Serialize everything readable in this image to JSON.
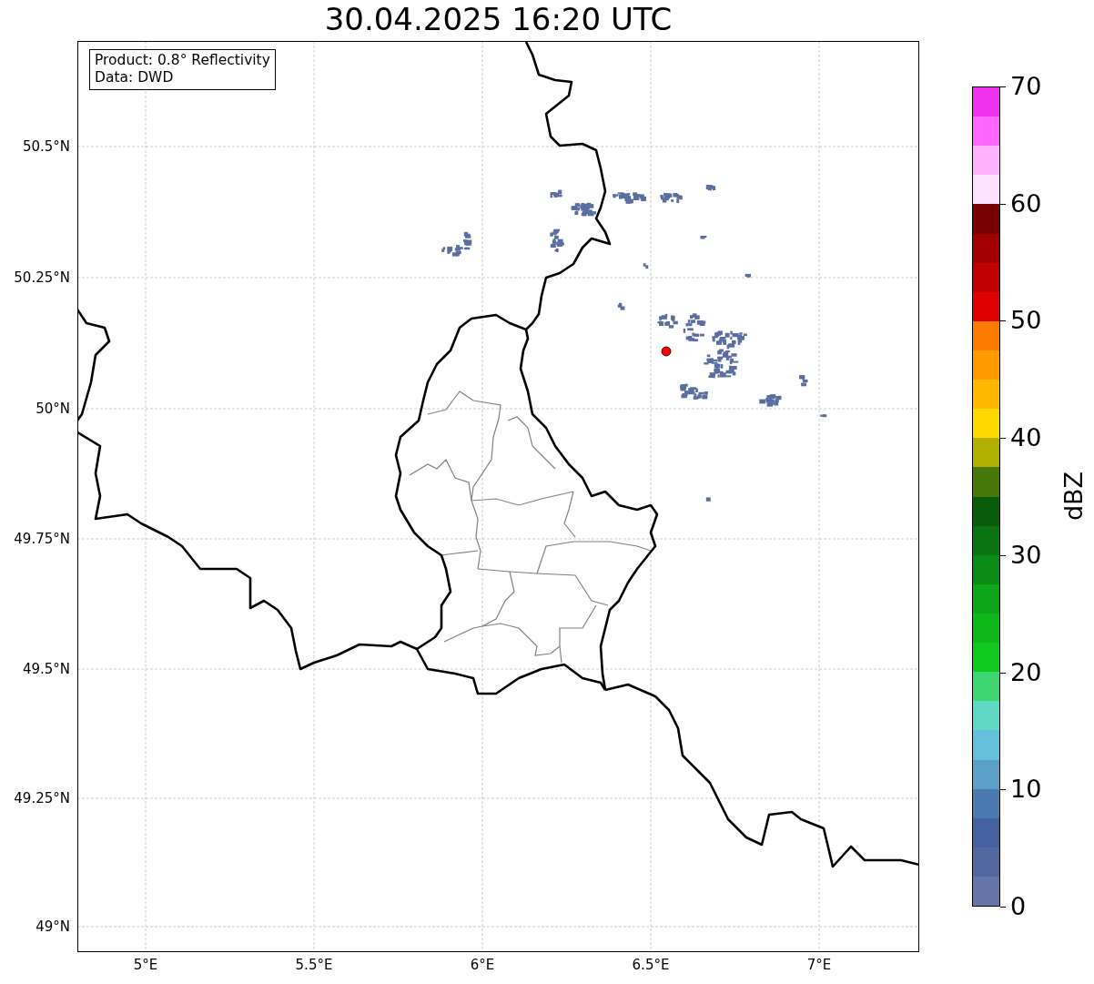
{
  "title": "30.04.2025 16:20 UTC",
  "info_box": [
    "Product: 0.8° Reflectivity",
    "Data: DWD"
  ],
  "map": {
    "lat_ticks": [
      "50.5°N",
      "50.25°N",
      "50°N",
      "49.75°N",
      "49.5°N",
      "49.25°N",
      "49°N"
    ],
    "lon_ticks": [
      "5°E",
      "5.5°E",
      "6°E",
      "6.5°E",
      "7°E"
    ]
  },
  "colorbar": {
    "ticks": [
      "70",
      "60",
      "50",
      "40",
      "30",
      "20",
      "10",
      "0"
    ],
    "segments": [
      {
        "color": "#ee33ee"
      },
      {
        "color": "#ff66ff"
      },
      {
        "color": "#ffb3ff"
      },
      {
        "color": "#ffe0ff"
      },
      {
        "color": "#780000"
      },
      {
        "color": "#a00000"
      },
      {
        "color": "#c00000"
      },
      {
        "color": "#e00000"
      },
      {
        "color": "#ff7a00"
      },
      {
        "color": "#ff9a00"
      },
      {
        "color": "#ffb800"
      },
      {
        "color": "#ffd800"
      },
      {
        "color": "#b0b000"
      },
      {
        "color": "#487808"
      },
      {
        "color": "#085c0c"
      },
      {
        "color": "#0a7412"
      },
      {
        "color": "#0c8a16"
      },
      {
        "color": "#0ea618"
      },
      {
        "color": "#0eb81a"
      },
      {
        "color": "#10c81e"
      },
      {
        "color": "#3ed670"
      },
      {
        "color": "#60d8c4"
      },
      {
        "color": "#66c0dc"
      },
      {
        "color": "#5aa0c8"
      },
      {
        "color": "#4a7ab0"
      },
      {
        "color": "#4560a0"
      },
      {
        "color": "#5468a0"
      },
      {
        "color": "#6676a8"
      }
    ],
    "label": "dBZ"
  }
}
